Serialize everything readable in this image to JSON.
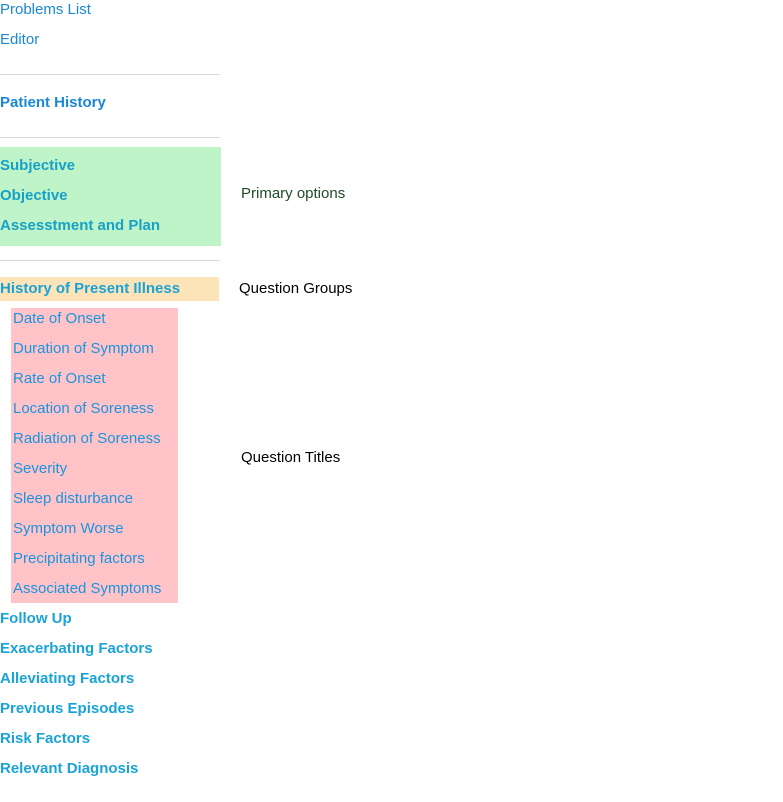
{
  "top_links": {
    "problems_list": "Problems List",
    "editor": "Editor"
  },
  "patient_history": "Patient History",
  "primary_options": [
    "Subjective",
    "Objective",
    "Assesstment and Plan"
  ],
  "question_group_selected": "History of Present Illness",
  "question_titles": [
    "Date of Onset",
    "Duration of Symptom",
    "Rate of Onset",
    "Location of Soreness",
    "Radiation of Soreness",
    "Severity",
    "Sleep disturbance",
    "Symptom Worse",
    "Precipitating factors",
    "Associated Symptoms"
  ],
  "question_groups_other": [
    "Follow Up",
    "Exacerbating Factors",
    "Alleviating Factors",
    "Previous Episodes",
    "Risk Factors",
    "Relevant Diagnosis"
  ],
  "annotations": {
    "primary_options": "Primary options",
    "question_groups": "Question Groups",
    "question_titles": "Question Titles"
  },
  "colors": {
    "primary_box": "#bff4c9",
    "group_highlight": "#fde3b8",
    "titles_box": "#ffc3c8",
    "link": "#1a88d6"
  }
}
